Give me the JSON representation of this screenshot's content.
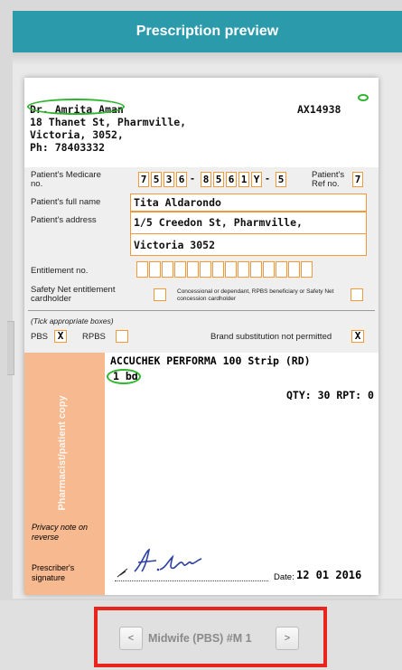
{
  "header": {
    "title": "Prescription preview"
  },
  "prescriber": {
    "name": "Dr. Amrita Aman",
    "address_line1": "18 Thanet St, Pharmville,",
    "address_line2": "Victoria, 3052,",
    "phone": "Ph: 78403332",
    "prescriber_no": "AX14938"
  },
  "patient": {
    "medicare_label": "Patient's Medicare no.",
    "medicare_digits": [
      "7",
      "5",
      "3",
      "6",
      "-",
      "8",
      "5",
      "6",
      "1",
      "Y",
      "-",
      "5"
    ],
    "ref_label": "Patient's Ref no.",
    "ref_no": "7",
    "name_label": "Patient's full name",
    "name": "Tita Aldarondo",
    "address_label": "Patient's address",
    "address_line1": "1/5 Creedon St, Pharmville,",
    "address_line2": "Victoria 3052"
  },
  "entitlement": {
    "label": "Entitlement no.",
    "safety_net_label": "Safety Net entitlement cardholder",
    "concessional_label": "Concessional or dependant, RPBS beneficiary or Safety Net concession cardholder"
  },
  "boxes": {
    "tick_note": "(Tick appropriate boxes)",
    "pbs_label": "PBS",
    "pbs_value": "X",
    "rpbs_label": "RPBS",
    "brand_label": "Brand substitution not permitted",
    "brand_value": "X"
  },
  "item": {
    "drug": "ACCUCHEK PERFORMA 100  Strip (RD)",
    "dose": "1 bd",
    "qty": "QTY: 30 RPT: 0"
  },
  "copy_label": "Pharmacist/patient copy",
  "privacy_note": "Privacy note on reverse",
  "signature_label": "Prescriber's signature",
  "date_label": "Date:",
  "date_value": "12 01 2016",
  "footer": {
    "prev": "<",
    "label": "Midwife (PBS) #M 1",
    "next": ">"
  }
}
